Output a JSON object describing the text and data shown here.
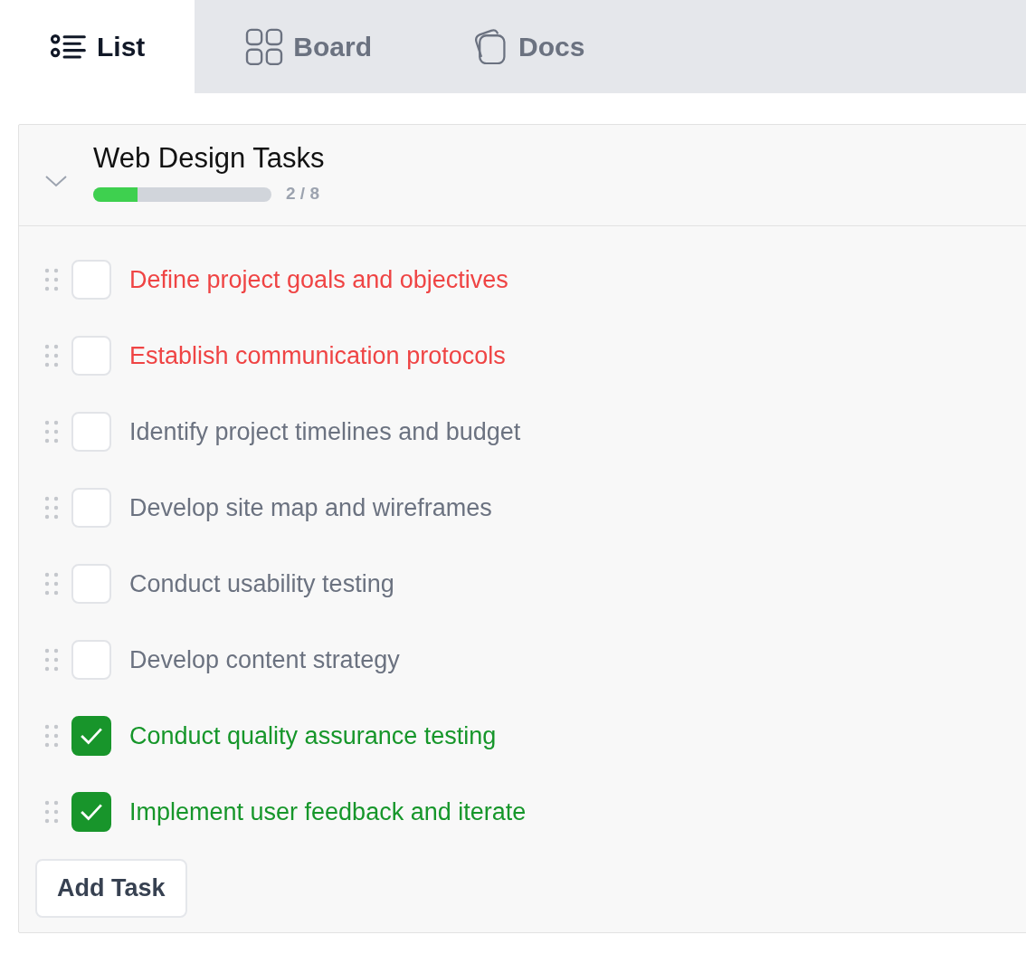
{
  "tabs": [
    {
      "label": "List",
      "kind": "list",
      "selected": true
    },
    {
      "label": "Board",
      "kind": "board",
      "selected": false
    },
    {
      "label": "Docs",
      "kind": "docs",
      "selected": false
    }
  ],
  "task_group": {
    "title": "Web Design Tasks",
    "expanded": true,
    "progress": {
      "level": 0.25,
      "reading": "2 / 8"
    },
    "tasks": [
      {
        "label": "Define project goals and objectives",
        "checked": false,
        "color": "#ef4444"
      },
      {
        "label": "Establish communication protocols",
        "checked": false,
        "color": "#ef4444"
      },
      {
        "label": "Identify project timelines and budget",
        "checked": false,
        "color": "#6b7280"
      },
      {
        "label": "Develop site map and wireframes",
        "checked": false,
        "color": "#6b7280"
      },
      {
        "label": "Conduct usability testing",
        "checked": false,
        "color": "#6b7280"
      },
      {
        "label": "Develop content strategy",
        "checked": false,
        "color": "#6b7280"
      },
      {
        "label": "Conduct quality assurance testing",
        "checked": true,
        "color": "#16962a"
      },
      {
        "label": "Implement user feedback and iterate",
        "checked": true,
        "color": "#16962a"
      }
    ],
    "add_button": "Add Task"
  }
}
